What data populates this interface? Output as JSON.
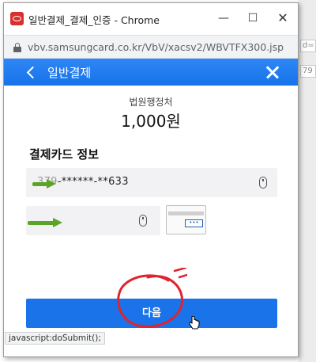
{
  "window": {
    "title": "일반결제_결제_인증 - Chrome",
    "minimize_label": "—",
    "maximize_label": "☐",
    "close_label": "✕"
  },
  "address_bar": {
    "url": "vbv.samsungcard.co.kr/VbV/xacsv2/WBVTFX300.jsp"
  },
  "header": {
    "title": "일반결제"
  },
  "payment": {
    "merchant": "법원행정처",
    "amount": "1,000원"
  },
  "card_section": {
    "title": "결제카드 정보",
    "card_number_blurred": "379",
    "card_number_masked": "-******-**633",
    "card_icon_code": "•••"
  },
  "next_button": {
    "label": "다음"
  },
  "status_bar": {
    "text": "javascript:doSubmit();"
  },
  "background_page": {
    "fragment_1": "d=",
    "fragment_2": "79"
  },
  "colors": {
    "accent": "#1a73e8",
    "annotation_red": "#e0232e",
    "annotation_arrow": "#5aa526"
  }
}
